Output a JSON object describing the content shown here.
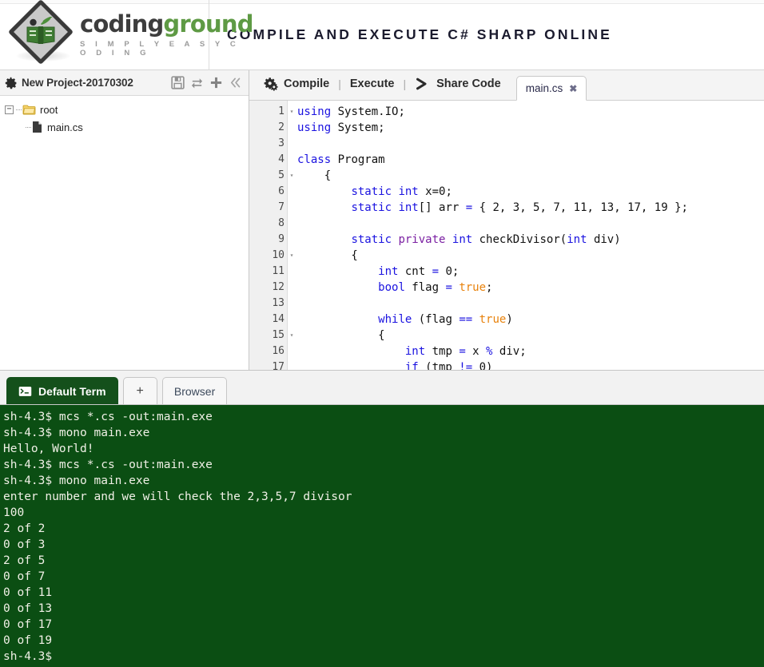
{
  "header": {
    "brand_primary": "coding",
    "brand_secondary": "ground",
    "brand_tagline": "S I M P L Y E A S Y C O D I N G",
    "title": "COMPILE AND EXECUTE C# SHARP ONLINE",
    "brand_color_primary": "#3d3d3d",
    "brand_color_secondary": "#5e9a44"
  },
  "sidebar": {
    "project_name": "New Project-20170302",
    "icons": {
      "settings": "gear-icon",
      "save": "save-icon",
      "refresh": "refresh-icon",
      "add": "plus-icon",
      "collapse": "double-chevron-left-icon"
    },
    "tree": {
      "root_label": "root",
      "expander_glyph": "−",
      "children": [
        {
          "label": "main.cs",
          "type": "file"
        }
      ]
    }
  },
  "editor": {
    "actions": [
      {
        "label": "Compile",
        "icon": "gears-icon"
      },
      {
        "label": "Execute",
        "icon": "none"
      },
      {
        "label": "Share Code",
        "icon": "chevron-right-icon"
      }
    ],
    "separator": "|",
    "tabs": [
      {
        "label": "main.cs",
        "close": "✖",
        "active": true
      }
    ],
    "lines": [
      {
        "n": "1",
        "fold": "▾",
        "html": "<span class=\"k\">using</span> System.IO;"
      },
      {
        "n": "2",
        "fold": "",
        "html": "<span class=\"k\">using</span> System;"
      },
      {
        "n": "3",
        "fold": "",
        "html": ""
      },
      {
        "n": "4",
        "fold": "",
        "html": "<span class=\"k\">class</span> Program"
      },
      {
        "n": "5",
        "fold": "▾",
        "html": "    {"
      },
      {
        "n": "6",
        "fold": "",
        "html": "        <span class=\"k\">static</span> <span class=\"k\">int</span> x=<span class=\"num\">0</span>;"
      },
      {
        "n": "7",
        "fold": "",
        "html": "        <span class=\"k\">static</span> <span class=\"k\">int</span>[] arr <span class=\"op\">=</span> { 2, 3, 5, 7, 11, 13, 17, 19 };"
      },
      {
        "n": "8",
        "fold": "",
        "html": ""
      },
      {
        "n": "9",
        "fold": "",
        "html": "        <span class=\"k\">static</span> <span class=\"kp\">private</span> <span class=\"k\">int</span> checkDivisor(<span class=\"k\">int</span> div)"
      },
      {
        "n": "10",
        "fold": "▾",
        "html": "        {"
      },
      {
        "n": "11",
        "fold": "",
        "html": "            <span class=\"k\">int</span> cnt <span class=\"op\">=</span> <span class=\"num\">0</span>;"
      },
      {
        "n": "12",
        "fold": "",
        "html": "            <span class=\"k\">bool</span> flag <span class=\"op\">=</span> <span class=\"lit\">true</span>;"
      },
      {
        "n": "13",
        "fold": "",
        "html": ""
      },
      {
        "n": "14",
        "fold": "",
        "html": "            <span class=\"k\">while</span> (flag <span class=\"op\">==</span> <span class=\"lit\">true</span>)"
      },
      {
        "n": "15",
        "fold": "▾",
        "html": "            {"
      },
      {
        "n": "16",
        "fold": "",
        "html": "                <span class=\"k\">int</span> tmp <span class=\"op\">=</span> x <span class=\"op\">%</span> div;"
      },
      {
        "n": "17",
        "fold": "",
        "html": "                <span class=\"k\">if</span> (tmp <span class=\"op\">!=</span> <span class=\"num\">0</span>)"
      }
    ],
    "code_text": [
      "using System.IO;",
      "using System;",
      "",
      "class Program",
      "    {",
      "        static int x=0;",
      "        static int[] arr = { 2, 3, 5, 7, 11, 13, 17, 19 };",
      "",
      "        static private int checkDivisor(int div)",
      "        {",
      "            int cnt = 0;",
      "            bool flag = true;",
      "",
      "            while (flag == true)",
      "            {",
      "                int tmp = x % div;",
      "                if (tmp != 0)"
    ]
  },
  "terminal": {
    "tabs": [
      {
        "label": "Default Term",
        "icon": "terminal-icon",
        "active": true
      },
      {
        "label": "+",
        "icon": "plus-icon",
        "active": false
      },
      {
        "label": "Browser",
        "icon": "none",
        "active": false
      }
    ],
    "background_color": "#0b4e13",
    "text_color": "#f0f0e6",
    "output": [
      "sh-4.3$ mcs *.cs -out:main.exe",
      "sh-4.3$ mono main.exe",
      "Hello, World!",
      "sh-4.3$ mcs *.cs -out:main.exe",
      "sh-4.3$ mono main.exe",
      "enter number and we will check the 2,3,5,7 divisor",
      "100",
      "2 of 2",
      "0 of 3",
      "2 of 5",
      "0 of 7",
      "0 of 11",
      "0 of 13",
      "0 of 17",
      "0 of 19",
      "sh-4.3$"
    ]
  }
}
